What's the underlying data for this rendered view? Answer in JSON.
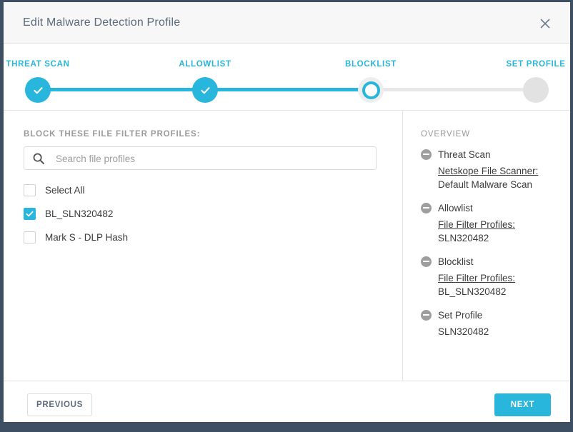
{
  "header": {
    "title": "Edit Malware Detection Profile",
    "close_icon": "close-icon"
  },
  "stepper": {
    "steps": [
      {
        "label": "THREAT SCAN",
        "state": "done"
      },
      {
        "label": "ALLOWLIST",
        "state": "done"
      },
      {
        "label": "BLOCKLIST",
        "state": "current"
      },
      {
        "label": "SET PROFILE",
        "state": "todo"
      }
    ],
    "active_color": "#29b6dd",
    "inactive_color": "#9b9b9b",
    "track_done_color": "#29b6dd",
    "track_todo_color": "#e8e8e8"
  },
  "left": {
    "section_label": "BLOCK THESE FILE FILTER PROFILES:",
    "search": {
      "placeholder": "Search file profiles",
      "value": "",
      "icon": "search-icon"
    },
    "checkboxes": [
      {
        "label": "Select All",
        "checked": false
      },
      {
        "label": "BL_SLN320482",
        "checked": true
      },
      {
        "label": "Mark S - DLP Hash",
        "checked": false
      }
    ]
  },
  "overview": {
    "title": "OVERVIEW",
    "groups": [
      {
        "name": "Threat Scan",
        "sub_key": "Netskope File Scanner:",
        "sub_value": "Default Malware Scan"
      },
      {
        "name": "Allowlist",
        "sub_key": "File Filter Profiles:",
        "sub_value": "SLN320482"
      },
      {
        "name": "Blocklist",
        "sub_key": "File Filter Profiles:",
        "sub_value": "BL_SLN320482"
      },
      {
        "name": "Set Profile",
        "sub_key": "",
        "sub_value": "SLN320482"
      }
    ]
  },
  "footer": {
    "previous_label": "PREVIOUS",
    "next_label": "NEXT",
    "next_color": "#29b6dd"
  }
}
